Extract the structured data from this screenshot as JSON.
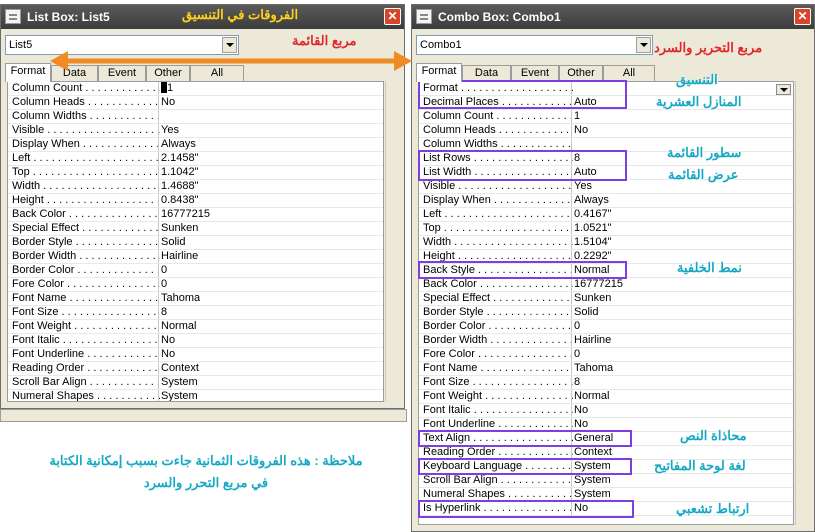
{
  "colors": {
    "annotation_cyan": "#15a9c4",
    "annotation_red": "#e0262b",
    "annotation_yellow": "#ffd21c",
    "highlight_purple": "#7b3fe4",
    "arrow_orange": "#f08a24"
  },
  "left_window": {
    "title": "List Box: List5",
    "title_annotation": "الفروقات في التنسيق",
    "combo_value": "List5",
    "tabs": [
      "Format",
      "Data",
      "Event",
      "Other",
      "All"
    ],
    "properties": [
      {
        "label": "Column Count",
        "value": "1"
      },
      {
        "label": "Column Heads",
        "value": "No"
      },
      {
        "label": "Column Widths",
        "value": ""
      },
      {
        "label": "Visible",
        "value": "Yes"
      },
      {
        "label": "Display When",
        "value": "Always"
      },
      {
        "label": "Left",
        "value": "2.1458\""
      },
      {
        "label": "Top",
        "value": "1.1042\""
      },
      {
        "label": "Width",
        "value": "1.4688\""
      },
      {
        "label": "Height",
        "value": "0.8438\""
      },
      {
        "label": "Back Color",
        "value": "16777215"
      },
      {
        "label": "Special Effect",
        "value": "Sunken"
      },
      {
        "label": "Border Style",
        "value": "Solid"
      },
      {
        "label": "Border Width",
        "value": "Hairline"
      },
      {
        "label": "Border Color",
        "value": "0"
      },
      {
        "label": "Fore Color",
        "value": "0"
      },
      {
        "label": "Font Name",
        "value": "Tahoma"
      },
      {
        "label": "Font Size",
        "value": "8"
      },
      {
        "label": "Font Weight",
        "value": "Normal"
      },
      {
        "label": "Font Italic",
        "value": "No"
      },
      {
        "label": "Font Underline",
        "value": "No"
      },
      {
        "label": "Reading Order",
        "value": "Context"
      },
      {
        "label": "Scroll Bar Align",
        "value": "System"
      },
      {
        "label": "Numeral Shapes",
        "value": "System"
      }
    ]
  },
  "right_window": {
    "title": "Combo Box: Combo1",
    "combo_value": "Combo1",
    "tabs": [
      "Format",
      "Data",
      "Event",
      "Other",
      "All"
    ],
    "properties": [
      {
        "label": "Format",
        "value": ""
      },
      {
        "label": "Decimal Places",
        "value": "Auto"
      },
      {
        "label": "Column Count",
        "value": "1"
      },
      {
        "label": "Column Heads",
        "value": "No"
      },
      {
        "label": "Column Widths",
        "value": ""
      },
      {
        "label": "List Rows",
        "value": "8"
      },
      {
        "label": "List Width",
        "value": "Auto"
      },
      {
        "label": "Visible",
        "value": "Yes"
      },
      {
        "label": "Display When",
        "value": "Always"
      },
      {
        "label": "Left",
        "value": "0.4167\""
      },
      {
        "label": "Top",
        "value": "1.0521\""
      },
      {
        "label": "Width",
        "value": "1.5104\""
      },
      {
        "label": "Height",
        "value": "0.2292\""
      },
      {
        "label": "Back Style",
        "value": "Normal"
      },
      {
        "label": "Back Color",
        "value": "16777215"
      },
      {
        "label": "Special Effect",
        "value": "Sunken"
      },
      {
        "label": "Border Style",
        "value": "Solid"
      },
      {
        "label": "Border Color",
        "value": "0"
      },
      {
        "label": "Border Width",
        "value": "Hairline"
      },
      {
        "label": "Fore Color",
        "value": "0"
      },
      {
        "label": "Font Name",
        "value": "Tahoma"
      },
      {
        "label": "Font Size",
        "value": "8"
      },
      {
        "label": "Font Weight",
        "value": "Normal"
      },
      {
        "label": "Font Italic",
        "value": "No"
      },
      {
        "label": "Font Underline",
        "value": "No"
      },
      {
        "label": "Text Align",
        "value": "General"
      },
      {
        "label": "Reading Order",
        "value": "Context"
      },
      {
        "label": "Keyboard Language",
        "value": "System"
      },
      {
        "label": "Scroll Bar Align",
        "value": "System"
      },
      {
        "label": "Numeral Shapes",
        "value": "System"
      },
      {
        "label": "Is Hyperlink",
        "value": "No"
      }
    ]
  },
  "annotations": {
    "list_box_label": "مربع القائمة",
    "combo_box_label": "مربع التحرير والسرد",
    "format": "التنسيق",
    "decimal_places": "المنازل العشرية",
    "list_rows": "سطور القائمة",
    "list_width": "عرض القائمة",
    "back_style": "نمط الخلفية",
    "text_align": "محاذاة النص",
    "keyboard_language": "لغة لوحة المفاتيح",
    "is_hyperlink": "ارتباط تشعبي",
    "note_line1": "ملاحظة : هذه الفروقات الثمانية جاءت بسبب إمكانية الكتابة",
    "note_line2": "في مربع التحرر والسرد"
  }
}
